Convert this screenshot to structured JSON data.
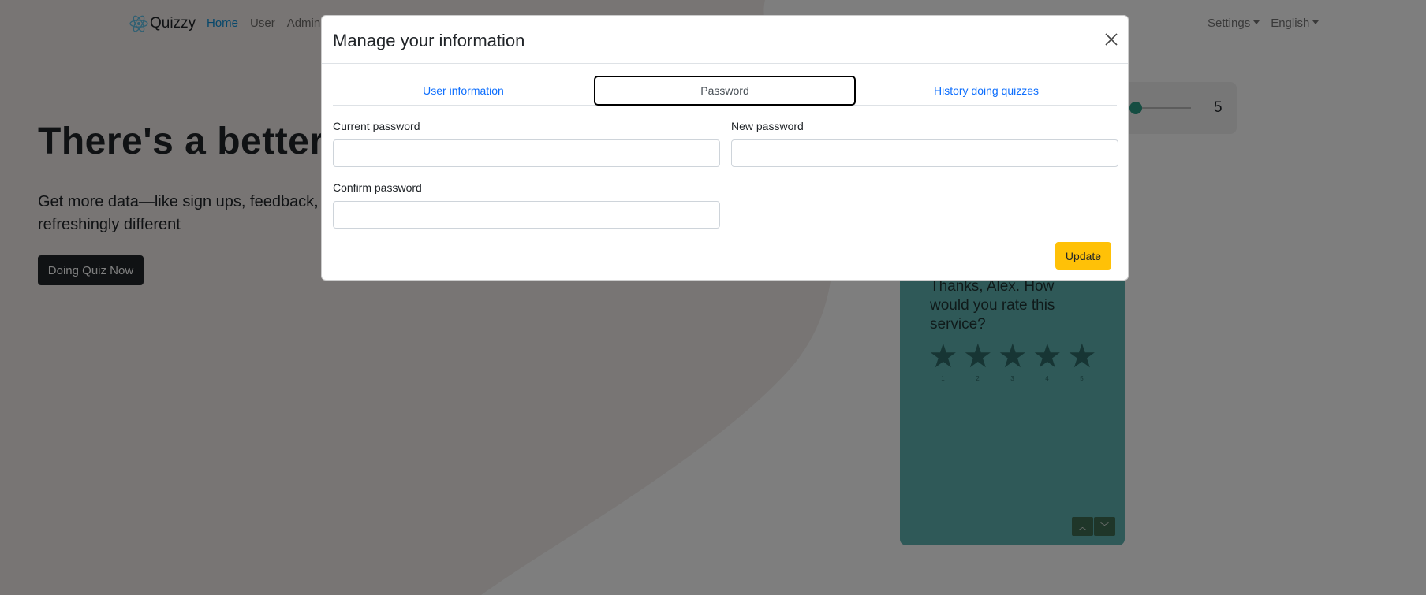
{
  "navbar": {
    "brand": "Quizzy",
    "links": [
      "Home",
      "User",
      "Admin"
    ],
    "settings_label": "Settings",
    "language_label": "English"
  },
  "hero": {
    "title": "There's a better w",
    "description": "Get more data—like sign ups, feedback, a refreshingly different",
    "button_label": "Doing Quiz Now"
  },
  "slider_card": {
    "value": "5",
    "level": 0.05
  },
  "rating_card": {
    "question": "Thanks, Alex. How would you rate this service?",
    "star_labels": [
      "1",
      "2",
      "3",
      "4",
      "5"
    ],
    "up_icon": "chevron-up-icon",
    "down_icon": "chevron-down-icon"
  },
  "modal": {
    "title": "Manage your information",
    "tabs": [
      "User information",
      "Password",
      "History doing quizzes"
    ],
    "active_tab": "Password",
    "fields": {
      "current_password": {
        "label": "Current password",
        "value": ""
      },
      "new_password": {
        "label": "New password",
        "value": ""
      },
      "confirm_password": {
        "label": "Confirm password",
        "value": ""
      }
    },
    "update_label": "Update"
  },
  "colors": {
    "accent": "#0d8fd6",
    "tab_link": "#0d6efd",
    "update_button": "#ffc107",
    "teal_card": "#5fb3b0",
    "dark_button": "#212529"
  }
}
